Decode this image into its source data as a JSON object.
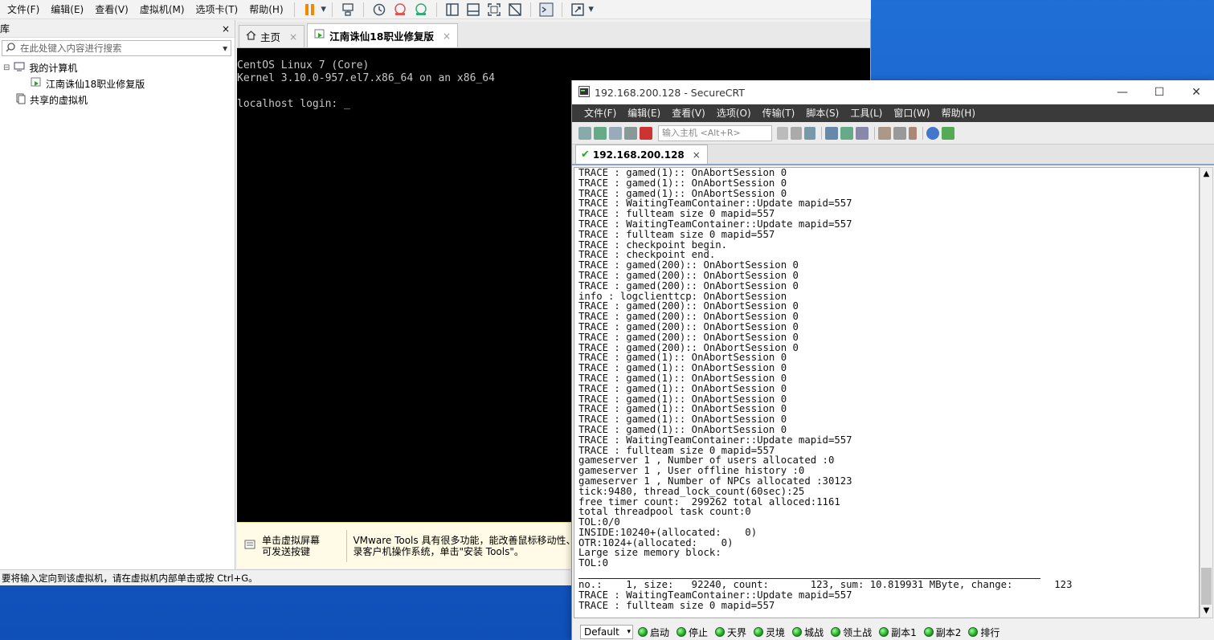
{
  "vmware": {
    "menu": [
      "文件(F)",
      "编辑(E)",
      "查看(V)",
      "虚拟机(M)",
      "选项卡(T)",
      "帮助(H)"
    ],
    "library": {
      "title": "库",
      "close": "×",
      "search_placeholder": "在此处键入内容进行搜索",
      "my_computer": "我的计算机",
      "vm_name": "江南诛仙18职业修复版",
      "shared": "共享的虚拟机"
    },
    "tabs": [
      {
        "label": "主页",
        "close": "×"
      },
      {
        "label": "江南诛仙18职业修复版",
        "close": "×"
      }
    ],
    "console": [
      "CentOS Linux 7 (Core)",
      "Kernel 3.10.0-957.el7.x86_64 on an x86_64",
      "",
      "localhost login: _"
    ],
    "vmtools": {
      "left_line1": "单击虚拟屏幕",
      "left_line2": "可发送按键",
      "right_line1": "VMware Tools 具有很多功能，能改善鼠标移动性、视频",
      "right_line2": "录客户机操作系统，单击\"安装 Tools\"。"
    },
    "status": "要将输入定向到该虚拟机，请在虚拟机内部单击或按 Ctrl+G。"
  },
  "crt": {
    "title": "192.168.200.128 - SecureCRT",
    "menu": [
      "文件(F)",
      "编辑(E)",
      "查看(V)",
      "选项(O)",
      "传输(T)",
      "脚本(S)",
      "工具(L)",
      "窗口(W)",
      "帮助(H)"
    ],
    "host_placeholder": "输入主机 <Alt+R>",
    "tab": {
      "label": "192.168.200.128",
      "close": "×"
    },
    "lines": [
      "TRACE : gamed(1):: OnAbortSession 0",
      "TRACE : gamed(1):: OnAbortSession 0",
      "TRACE : gamed(1):: OnAbortSession 0",
      "TRACE : WaitingTeamContainer::Update mapid=557",
      "TRACE : fullteam size 0 mapid=557",
      "TRACE : WaitingTeamContainer::Update mapid=557",
      "TRACE : fullteam size 0 mapid=557",
      "TRACE : checkpoint begin.",
      "TRACE : checkpoint end.",
      "TRACE : gamed(200):: OnAbortSession 0",
      "TRACE : gamed(200):: OnAbortSession 0",
      "TRACE : gamed(200):: OnAbortSession 0",
      "info : logclienttcp: OnAbortSession",
      "TRACE : gamed(200):: OnAbortSession 0",
      "TRACE : gamed(200):: OnAbortSession 0",
      "TRACE : gamed(200):: OnAbortSession 0",
      "TRACE : gamed(200):: OnAbortSession 0",
      "TRACE : gamed(200):: OnAbortSession 0",
      "TRACE : gamed(1):: OnAbortSession 0",
      "TRACE : gamed(1):: OnAbortSession 0",
      "TRACE : gamed(1):: OnAbortSession 0",
      "TRACE : gamed(1):: OnAbortSession 0",
      "TRACE : gamed(1):: OnAbortSession 0",
      "TRACE : gamed(1):: OnAbortSession 0",
      "TRACE : gamed(1):: OnAbortSession 0",
      "TRACE : gamed(1):: OnAbortSession 0",
      "TRACE : WaitingTeamContainer::Update mapid=557",
      "TRACE : fullteam size 0 mapid=557",
      "gameserver 1 , Number of users allocated :0",
      "gameserver 1 , User offline history :0",
      "gameserver 1 , Number of NPCs allocated :30123",
      "tick:9480, thread_lock_count(60sec):25",
      "free timer count:  299262 total alloced:1161",
      "total threadpool task count:0",
      "TOL:0/0",
      "INSIDE:10240+(allocated:    0)",
      "OTR:1024+(allocated:    0)",
      "Large size memory block:",
      "TOL:0",
      "",
      "no.:    1, size:   92240, count:       123, sum: 10.819931 MByte, change:       123",
      "TRACE : WaitingTeamContainer::Update mapid=557",
      "TRACE : fullteam size 0 mapid=557"
    ],
    "button_bar": {
      "session": "Default",
      "buttons": [
        "启动",
        "停止",
        "天界",
        "灵境",
        "城战",
        "领土战",
        "副本1",
        "副本2",
        "排行"
      ]
    }
  }
}
